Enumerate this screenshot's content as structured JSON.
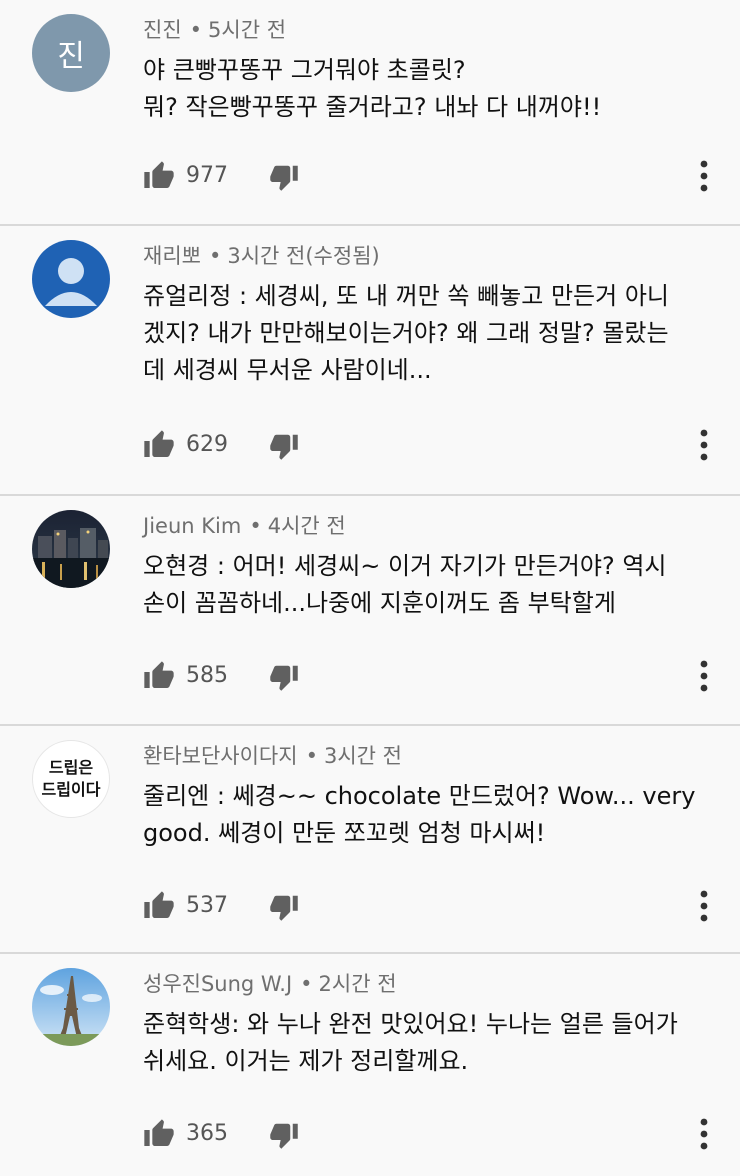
{
  "comments": [
    {
      "author": "진진",
      "time": "5시간 전",
      "avatar_letter": "진",
      "text": "야 큰빵꾸똥꾸 그거뭐야 초콜릿?\n뭐? 작은빵꾸똥꾸 줄거라고? 내놔 다 내꺼야!!",
      "likes": "977"
    },
    {
      "author": "재리뽀",
      "time": "3시간 전(수정됨)",
      "text": "쥬얼리정 : 세경씨, 또 내 꺼만 쏙 빼놓고 만든거 아니\n겠지? 내가 만만해보이는거야? 왜 그래 정말? 몰랐는\n데 세경씨 무서운 사람이네...",
      "likes": "629"
    },
    {
      "author": "Jieun Kim",
      "time": "4시간 전",
      "text": "오현경 : 어머! 세경씨~ 이거 자기가 만든거야? 역시\n손이 꼼꼼하네...나중에 지훈이꺼도 좀 부탁할게",
      "likes": "585"
    },
    {
      "author": "환타보단사이다지",
      "time": "3시간 전",
      "avatar_text": [
        "드립은",
        "드립이다"
      ],
      "text": "줄리엔 : 쎄경~~ chocolate 만드렀어? Wow... very\ngood. 쎄경이 만둔 쪼꼬렛 엄청 마시써!",
      "likes": "537"
    },
    {
      "author": "성우진Sung W.J",
      "time": "2시간 전",
      "text": "준혁학생: 와 누나 완전 맛있어요! 누나는 얼른 들어가\n쉬세요. 이거는 제가 정리할께요.",
      "likes": "365"
    }
  ],
  "colors": {
    "background": "#f9f9f9",
    "divider": "#d9d9d9",
    "meta_text": "#6f6f6f",
    "icon": "#606060"
  },
  "icons": [
    "like-icon",
    "dislike-icon",
    "more-vertical-icon"
  ]
}
